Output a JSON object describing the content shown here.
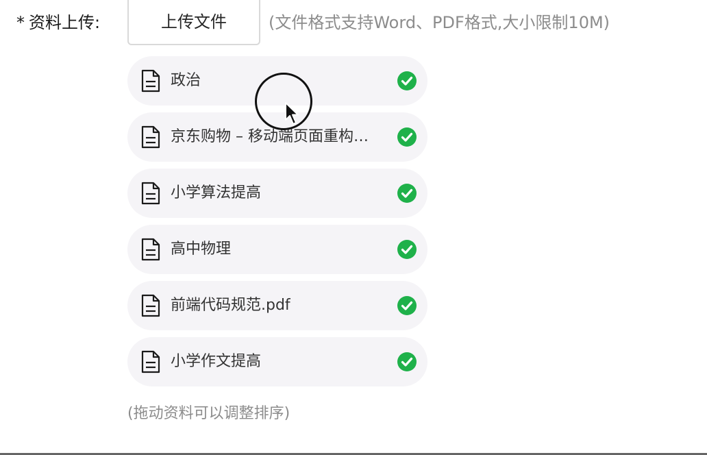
{
  "field": {
    "required_mark": "*",
    "label": "资料上传:"
  },
  "upload": {
    "button_label": "上传文件",
    "hint": "(文件格式支持Word、PDF格式,大小限制10M)"
  },
  "files": [
    {
      "name": "政治",
      "icon": "document-icon",
      "status_icon": "check-circle-icon"
    },
    {
      "name": "京东购物 – 移动端页面重构…",
      "icon": "document-icon",
      "status_icon": "check-circle-icon"
    },
    {
      "name": "小学算法提高",
      "icon": "document-icon",
      "status_icon": "check-circle-icon"
    },
    {
      "name": "高中物理",
      "icon": "document-icon",
      "status_icon": "check-circle-icon"
    },
    {
      "name": "前端代码规范.pdf",
      "icon": "document-icon",
      "status_icon": "check-circle-icon"
    },
    {
      "name": "小学作文提高",
      "icon": "document-icon",
      "status_icon": "check-circle-icon"
    }
  ],
  "drag_hint": "(拖动资料可以调整排序)",
  "colors": {
    "item_background": "#f5f4f7",
    "success": "#1fb14a",
    "hint_text": "#8c8c8c",
    "button_border": "#d9d9d9"
  }
}
